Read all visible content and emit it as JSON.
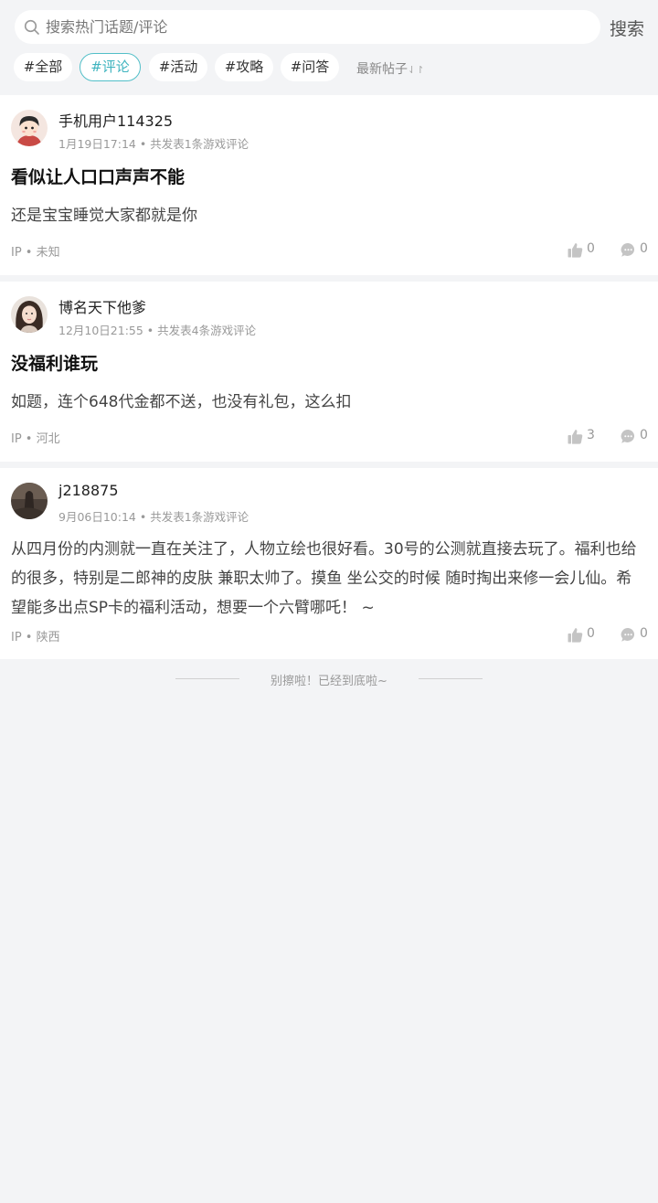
{
  "search": {
    "placeholder": "搜索热门话题/评论",
    "button_label": "搜索"
  },
  "tabs": [
    {
      "label": "#全部",
      "active": false
    },
    {
      "label": "#评论",
      "active": true
    },
    {
      "label": "#活动",
      "active": false
    },
    {
      "label": "#攻略",
      "active": false
    },
    {
      "label": "#问答",
      "active": false
    }
  ],
  "sort": {
    "label": "最新帖子",
    "icon": "sort-arrows-icon"
  },
  "accent_color": "#3fb4bf",
  "posts": [
    {
      "username": "手机用户114325",
      "meta": "1月19日17:14 • 共发表1条游戏评论",
      "title": "看似让人口口声声不能",
      "body": "还是宝宝睡觉大家都就是你",
      "ip": "IP • 未知",
      "likes": "0",
      "comments": "0"
    },
    {
      "username": "博名天下他爹",
      "meta": "12月10日21:55 • 共发表4条游戏评论",
      "title": "没福利谁玩",
      "body": "如题，连个648代金都不送，也没有礼包，这么扣",
      "ip": "IP • 河北",
      "likes": "3",
      "comments": "0"
    },
    {
      "username": "j218875",
      "meta": "9月06日10:14 • 共发表1条游戏评论",
      "title": "",
      "body": "从四月份的内测就一直在关注了，人物立绘也很好看。30号的公测就直接去玩了。福利也给的很多，特别是二郎神的皮肤 兼职太帅了。摸鱼 坐公交的时候 随时掏出来修一会儿仙。希望能多出点SP卡的福利活动，想要一个六臂哪吒！ ~",
      "ip": "IP • 陕西",
      "likes": "0",
      "comments": "0"
    }
  ],
  "footer_text": "别擦啦！已经到底啦~"
}
